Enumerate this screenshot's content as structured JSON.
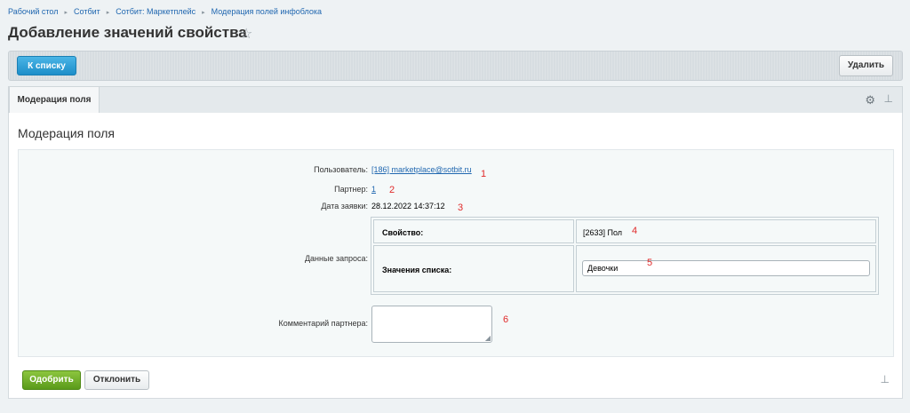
{
  "breadcrumb": {
    "items": [
      "Рабочий стол",
      "Сотбит",
      "Сотбит: Маркетплейс",
      "Модерация полей инфоблока"
    ],
    "separator": "▸"
  },
  "page": {
    "title": "Добавление значений свойства",
    "star": "☆"
  },
  "toolbar": {
    "back_label": "К списку",
    "delete_label": "Удалить"
  },
  "tabs": {
    "active_label": "Модерация поля",
    "gear": "⚙",
    "pin": "⊥"
  },
  "section": {
    "title": "Модерация поля"
  },
  "fields": {
    "user_label": "Пользователь:",
    "user_value": "[186] marketplace@sotbit.ru",
    "partner_label": "Партнер:",
    "partner_value": "1",
    "date_label": "Дата заявки:",
    "date_value": "28.12.2022 14:37:12",
    "request_label": "Данные запроса:",
    "property_label": "Свойство:",
    "property_value": "[2633] Пол",
    "list_values_label": "Значения списка:",
    "list_value": "Девочки",
    "comment_label": "Комментарий партнера:",
    "comment_value": ""
  },
  "annotations": [
    "1",
    "2",
    "3",
    "4",
    "5",
    "6"
  ],
  "footer": {
    "approve_label": "Одобрить",
    "reject_label": "Отклонить",
    "pin": "⊥"
  },
  "colors": {
    "accent_blue": "#1d8ec9",
    "approve_green": "#6aab28",
    "annotation_red": "#e02a2a",
    "link": "#2067b0"
  }
}
